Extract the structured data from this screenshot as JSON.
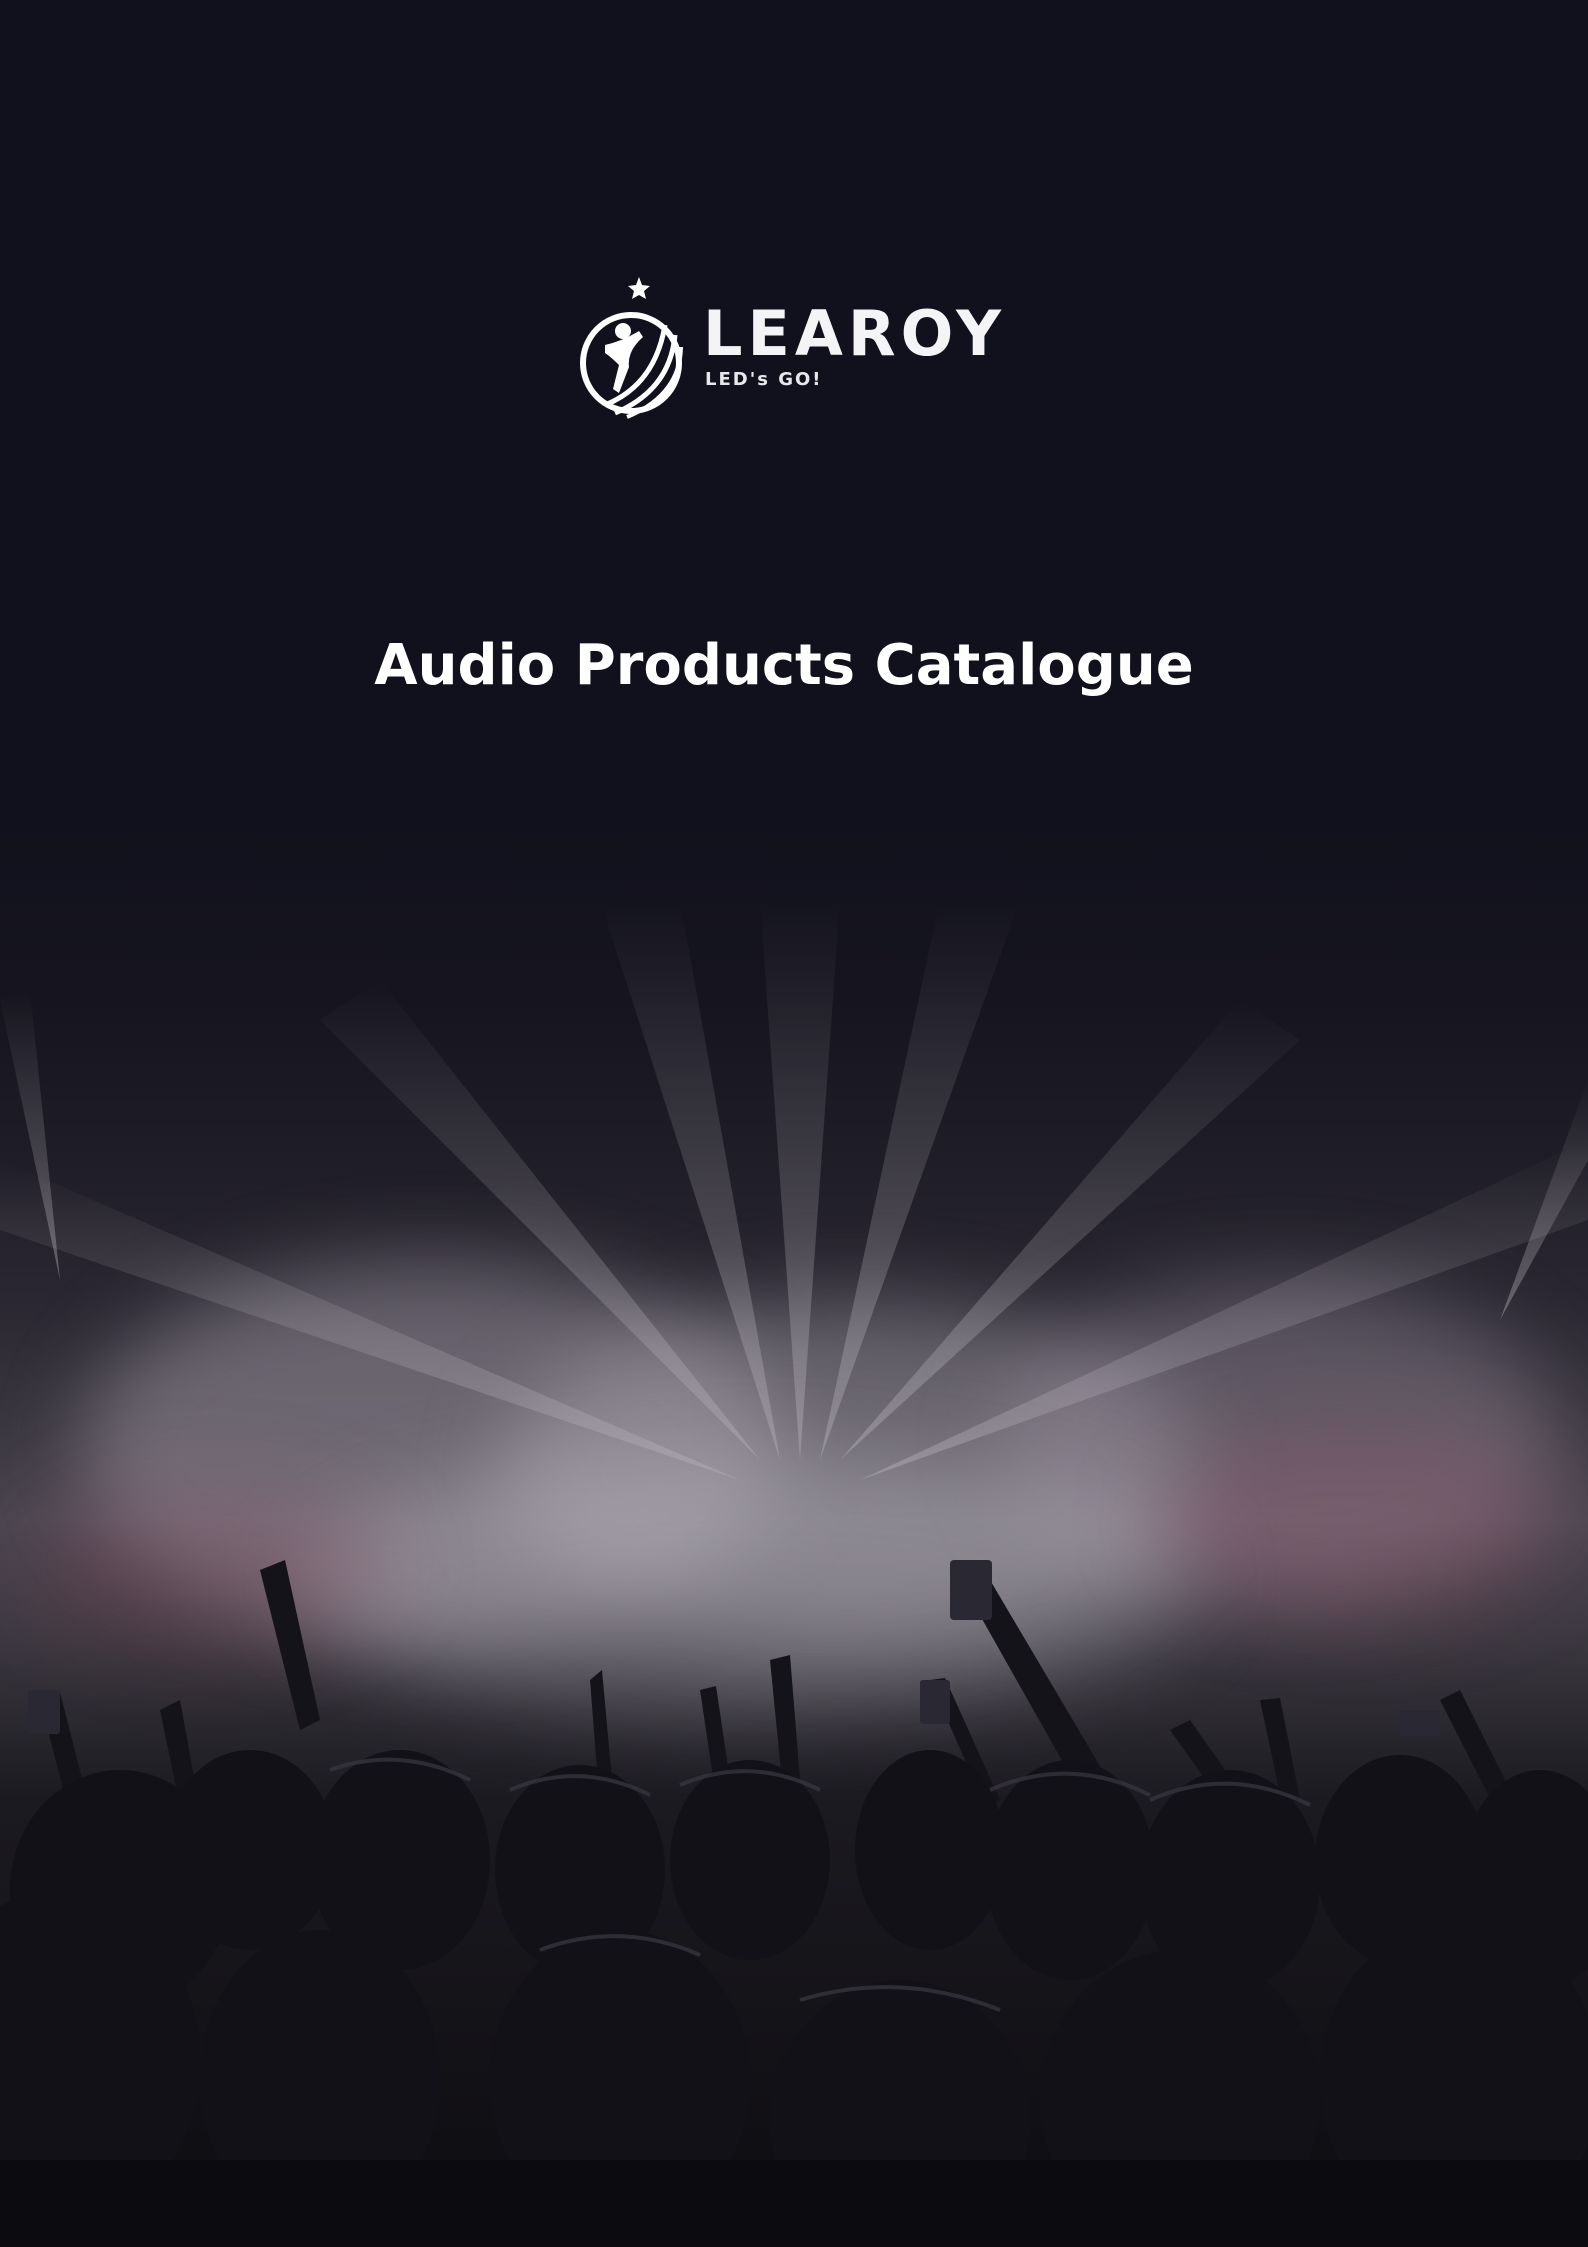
{
  "brand": {
    "name": "LEAROY",
    "tagline": "LED's GO!"
  },
  "document": {
    "title": "Audio Products Catalogue"
  },
  "icons": {
    "logo": "learoy-logo-icon",
    "background": "concert-crowd-photo"
  },
  "colors": {
    "background": "#11111d",
    "text": "#ffffff"
  }
}
